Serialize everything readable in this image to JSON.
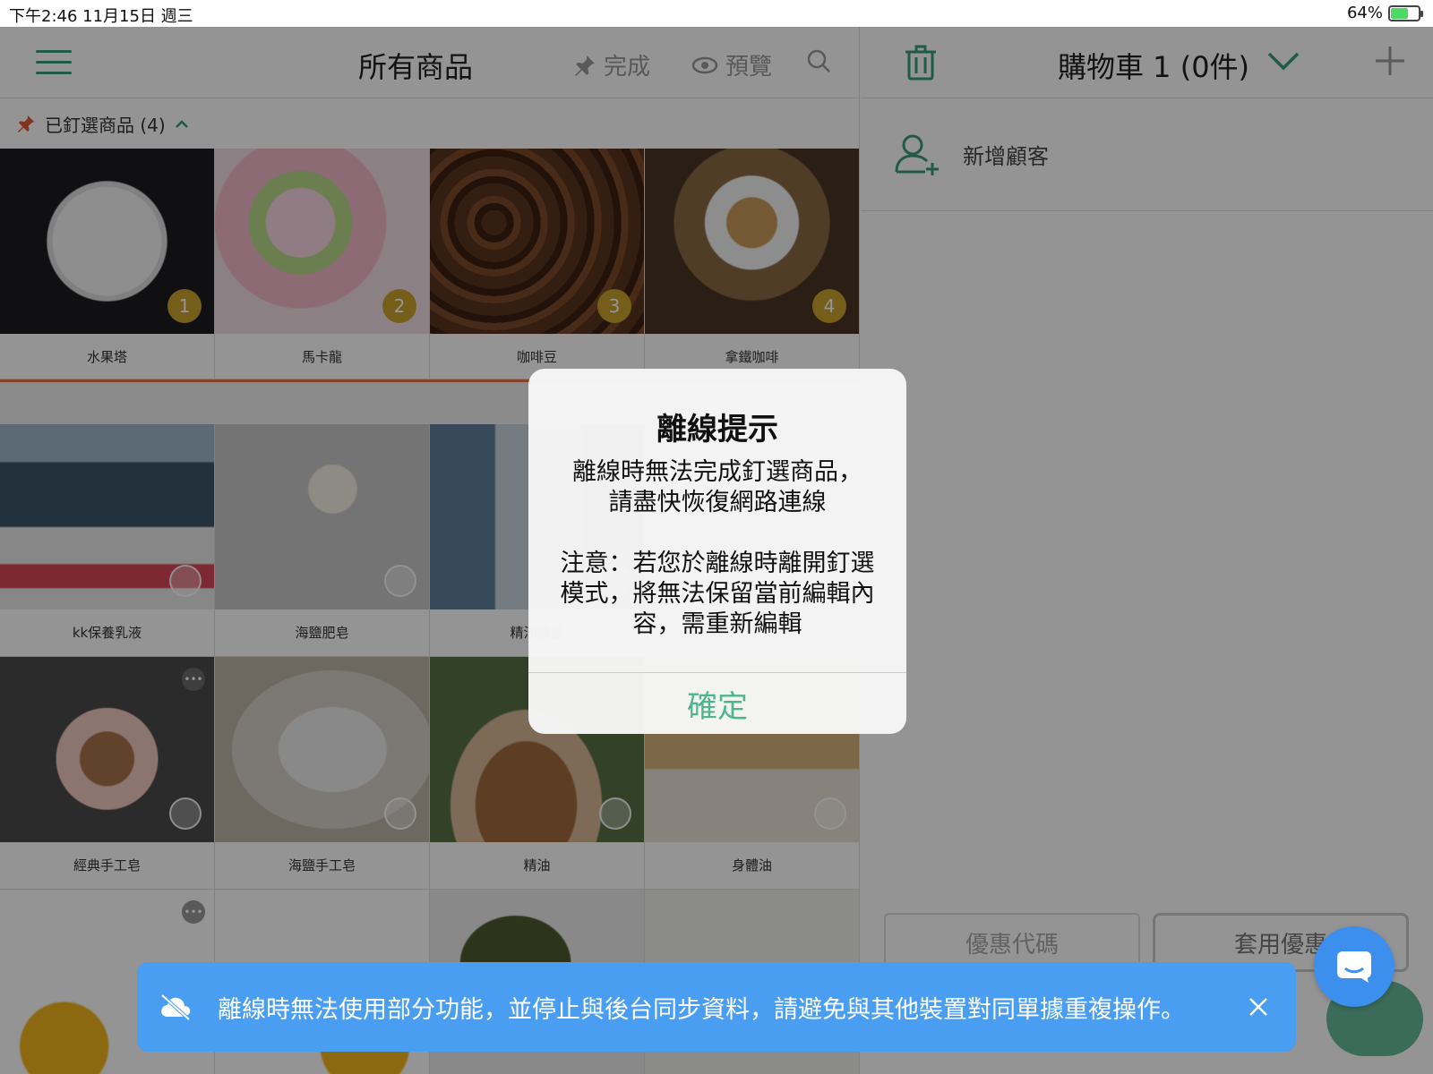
{
  "status_bar": {
    "time_date": "下午2:46   11月15日 週三",
    "battery": "64%",
    "battery_level": 0.64
  },
  "left": {
    "title": "所有商品",
    "actions": [
      {
        "label": "完成",
        "icon": "pin-icon"
      },
      {
        "label": "預覽",
        "icon": "eye-icon"
      },
      {
        "label": "",
        "icon": "search-icon"
      }
    ],
    "pinned_label": "已釘選商品 (4)",
    "pinned_products": [
      {
        "name": "水果塔",
        "badge": "1"
      },
      {
        "name": "馬卡龍",
        "badge": "2"
      },
      {
        "name": "咖啡豆",
        "badge": "3"
      },
      {
        "name": "拿鐵咖啡",
        "badge": "4"
      }
    ],
    "products_row2": [
      {
        "name": "kk保養乳液"
      },
      {
        "name": "海鹽肥皂"
      },
      {
        "name": "精油擴香"
      },
      {
        "name": ""
      }
    ],
    "products_row3": [
      {
        "name": "經典手工皂"
      },
      {
        "name": "海鹽手工皂"
      },
      {
        "name": "精油"
      },
      {
        "name": "身體油"
      }
    ]
  },
  "right": {
    "cart_title": "購物車 1 (0件)",
    "add_customer": "新增顧客",
    "coupon_placeholder": "優惠代碼",
    "apply_coupon": "套用優惠"
  },
  "modal": {
    "title": "離線提示",
    "message": "離線時無法完成釘選商品，\n請盡快恢復網路連線\n\n注意：若您於離線時離開釘選模式，將無法保留當前編輯內容，需重新編輯",
    "confirm": "確定"
  },
  "toast": {
    "message": "離線時無法使用部分功能，並停止與後台同步資料，請避免與其他裝置對同單據重複操作。"
  },
  "colors": {
    "accent": "#3a9b79",
    "badge": "#c9a22e",
    "toast": "#4a9ef2",
    "pin": "#e05a3a"
  }
}
